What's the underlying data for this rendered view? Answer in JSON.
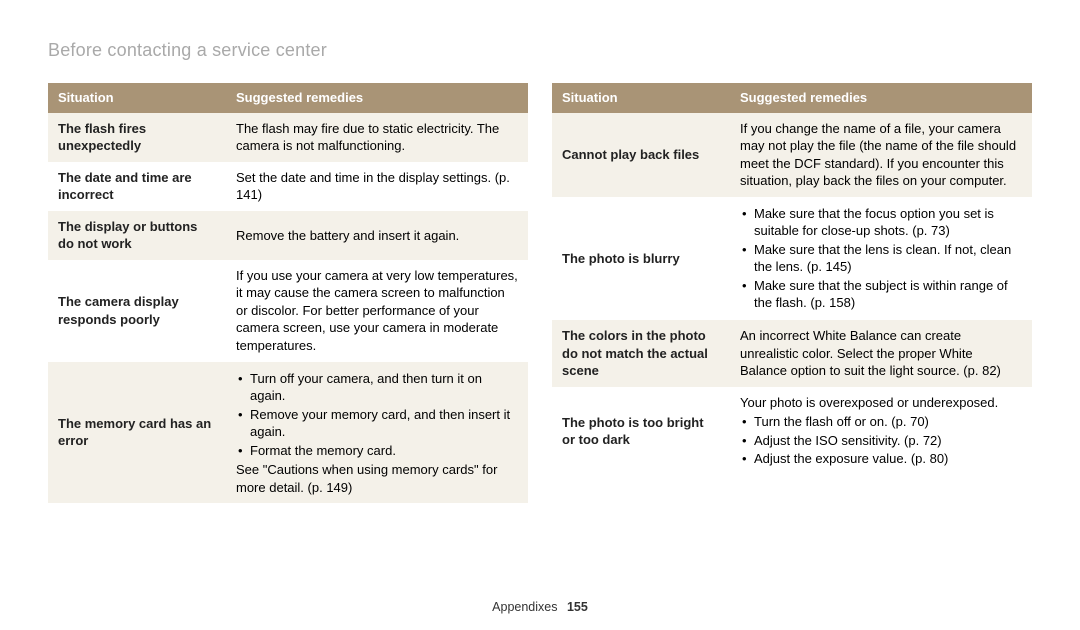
{
  "page_title": "Before contacting a service center",
  "footer": {
    "section": "Appendixes",
    "page_number": "155"
  },
  "headers": {
    "situation": "Situation",
    "remedies": "Suggested remedies"
  },
  "left_rows": [
    {
      "situation": "The flash fires unexpectedly",
      "remedy_text": "The flash may fire due to static electricity. The camera is not malfunctioning.",
      "zebra": true
    },
    {
      "situation": "The date and time are incorrect",
      "remedy_text": "Set the date and time in the display settings. (p. 141)",
      "zebra": false
    },
    {
      "situation": "The display or buttons do not work",
      "remedy_text": "Remove the battery and insert it again.",
      "zebra": true
    },
    {
      "situation": "The camera display responds poorly",
      "remedy_text": "If you use your camera at very low temperatures, it may cause the camera screen to malfunction or discolor. For better performance of your camera screen, use your camera in moderate temperatures.",
      "zebra": false
    },
    {
      "situation": "The memory card has an error",
      "remedy_bullets": [
        "Turn off your camera, and then turn it on again.",
        "Remove your memory card, and then insert it again.",
        "Format the memory card."
      ],
      "remedy_tail": "See \"Cautions when using memory cards\" for more detail. (p. 149)",
      "zebra": true
    }
  ],
  "right_rows": [
    {
      "situation": "Cannot play back files",
      "remedy_text": "If you change the name of a file, your camera may not play the file (the name of the file should meet the DCF standard). If you encounter this situation, play back the files on your computer.",
      "zebra": true
    },
    {
      "situation": "The photo is blurry",
      "remedy_bullets": [
        "Make sure that the focus option you set is suitable for close-up shots. (p. 73)",
        "Make sure that the lens is clean. If not, clean the lens. (p. 145)",
        "Make sure that the subject is within range of the flash. (p. 158)"
      ],
      "zebra": false
    },
    {
      "situation": "The colors in the photo do not match the actual scene",
      "remedy_text": "An incorrect White Balance can create unrealistic color. Select the proper White Balance option to suit the light source. (p. 82)",
      "zebra": true
    },
    {
      "situation": "The photo is too bright or too dark",
      "remedy_lead": "Your photo is overexposed or underexposed.",
      "remedy_bullets": [
        "Turn the flash off or on. (p. 70)",
        "Adjust the ISO sensitivity. (p. 72)",
        "Adjust the exposure value. (p. 80)"
      ],
      "zebra": false
    }
  ]
}
